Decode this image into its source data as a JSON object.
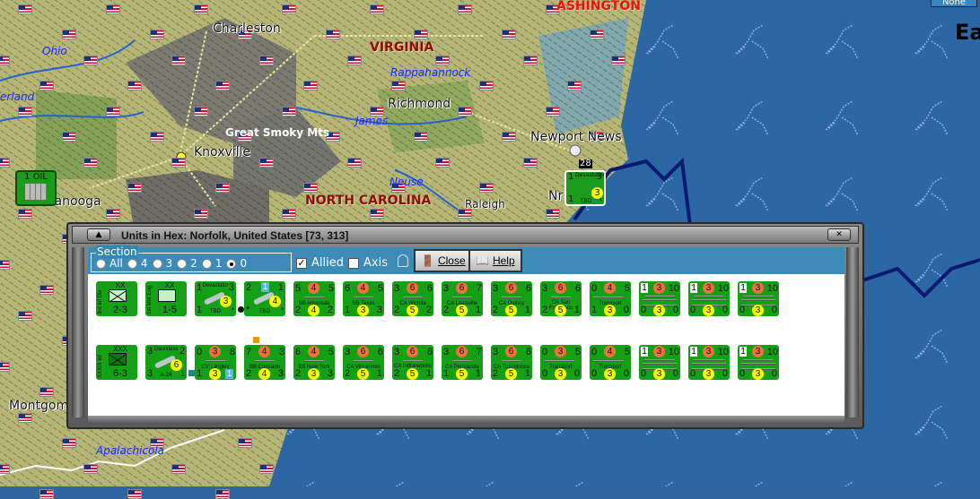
{
  "map": {
    "labels": {
      "charleston": "Charleston",
      "virginia": "VIRGINIA",
      "rappahannock": "Rappahannock",
      "richmond": "Richmond",
      "ohio": "Ohio",
      "cumberland": "erland",
      "james": "James",
      "smoky": "Great Smoky Mts",
      "knoxville": "Knoxville",
      "newport": "Newport News",
      "neuse": "Neuse",
      "nc": "NORTH CAROLINA",
      "raleigh": "Raleigh",
      "chattanooga": "tanooga",
      "washington": "ASHINGTON",
      "east": "Ea",
      "norfolk": "Nr",
      "montgomery": "Montgom",
      "apalachicola": "Apalachicola",
      "stack_count": "28"
    },
    "oil_counter": "1 OIL",
    "none_button": "None",
    "map_unit": {
      "tl": "1",
      "title": "Devastator",
      "tr": "3",
      "badge": "3",
      "bl": "1",
      "name": "TBD",
      "br": "*"
    }
  },
  "dialog": {
    "title": "Units in Hex: Norfolk, United States [73, 313]",
    "section_label": "Section",
    "section_options": [
      "All",
      "4",
      "3",
      "2",
      "1",
      "0"
    ],
    "section_selected": "0",
    "allied_label": "Allied",
    "allied_checked": true,
    "axis_label": "Axis",
    "axis_checked": false,
    "close_label": "Close",
    "help_label": "Help"
  },
  "units": [
    [
      {
        "kind": "land",
        "vlabel": "3rd Inf Div",
        "size": "XX",
        "str": "2-3",
        "sym": "inf"
      },
      {
        "kind": "land",
        "vlabel": "1st Mot Eng",
        "size": "XX",
        "str": "1-5",
        "sym": "eng"
      },
      {
        "kind": "air",
        "tl": "1",
        "title": "Devastator",
        "tr": "3",
        "badge": "3",
        "bl": "1",
        "name": "TBD",
        "br": "*",
        "marker": "black"
      },
      {
        "kind": "air",
        "tl": "2",
        "tcBox": "1",
        "tr": "1",
        "badge": "4",
        "bl": "*",
        "name": "TBD",
        "br": "*"
      },
      {
        "kind": "ship",
        "t": [
          "5",
          "4",
          "5"
        ],
        "name": "BB Arkansas",
        "b": [
          "2",
          "4",
          "2"
        ]
      },
      {
        "kind": "ship",
        "t": [
          "6",
          "4",
          "5"
        ],
        "name": "BB Texas",
        "b": [
          "1",
          "3",
          "3"
        ]
      },
      {
        "kind": "ship",
        "t": [
          "3",
          "6",
          "6"
        ],
        "name": "CA Wichita",
        "b": [
          "2",
          "5",
          "2"
        ]
      },
      {
        "kind": "ship",
        "t": [
          "3",
          "6",
          "7"
        ],
        "name": "CA Louisville",
        "b": [
          "2",
          "5",
          "1"
        ]
      },
      {
        "kind": "ship",
        "t": [
          "3",
          "6",
          "6"
        ],
        "name": "CA Quincy",
        "b": [
          "2",
          "5",
          "1"
        ]
      },
      {
        "kind": "ship",
        "t": [
          "3",
          "6",
          "6"
        ],
        "name": "CA San Francisco",
        "b": [
          "2",
          "5",
          "1"
        ]
      },
      {
        "kind": "transport",
        "t": [
          "0",
          "4",
          "5"
        ],
        "name": "Transport",
        "b": [
          "1",
          "3",
          "0"
        ]
      },
      {
        "kind": "convoy",
        "t": [
          "1",
          "3",
          "10"
        ],
        "b": [
          "0",
          "3",
          "0"
        ]
      },
      {
        "kind": "convoy",
        "t": [
          "1",
          "3",
          "10"
        ],
        "b": [
          "0",
          "3",
          "0"
        ]
      },
      {
        "kind": "convoy",
        "t": [
          "1",
          "3",
          "10"
        ],
        "b": [
          "0",
          "3",
          "0"
        ]
      }
    ],
    [
      {
        "kind": "land",
        "vlabel": "XXXIX Inf",
        "size": "XXX",
        "str": "6-3",
        "sym": "corps"
      },
      {
        "kind": "air",
        "tl": "3",
        "title": "Dauntless",
        "tr": "2",
        "badge": "6",
        "bl": "3",
        "name": "A-24",
        "br": "1",
        "marker": "teal"
      },
      {
        "kind": "ship",
        "t": [
          "0",
          "3",
          "8"
        ],
        "name": "CV Langley",
        "b": [
          "1",
          "3",
          "1"
        ],
        "brBox": true
      },
      {
        "kind": "ship",
        "t": [
          "7",
          "4",
          "3"
        ],
        "name": "BB Colorado",
        "b": [
          "2",
          "4",
          "3"
        ],
        "marker": "orange"
      },
      {
        "kind": "ship",
        "t": [
          "6",
          "4",
          "5"
        ],
        "name": "BB New York",
        "b": [
          "2",
          "3",
          "3"
        ]
      },
      {
        "kind": "ship",
        "t": [
          "3",
          "6",
          "6"
        ],
        "name": "CA Vincennes",
        "b": [
          "2",
          "5",
          "1"
        ]
      },
      {
        "kind": "ship",
        "t": [
          "3",
          "6",
          "6"
        ],
        "name": "CA Indianapolis",
        "b": [
          "2",
          "5",
          "1"
        ]
      },
      {
        "kind": "ship",
        "t": [
          "3",
          "6",
          "7"
        ],
        "name": "CA Pensacola",
        "b": [
          "1",
          "5",
          "1"
        ]
      },
      {
        "kind": "ship",
        "t": [
          "3",
          "6",
          "6"
        ],
        "name": "CA Tuscaloosa",
        "b": [
          "2",
          "5",
          "1"
        ]
      },
      {
        "kind": "transport",
        "t": [
          "0",
          "3",
          "5"
        ],
        "name": "Transport",
        "b": [
          "0",
          "3",
          "0"
        ]
      },
      {
        "kind": "transport",
        "t": [
          "0",
          "4",
          "5"
        ],
        "name": "Transport",
        "b": [
          "0",
          "3",
          "0"
        ]
      },
      {
        "kind": "convoy",
        "t": [
          "1",
          "3",
          "10"
        ],
        "b": [
          "0",
          "3",
          "0"
        ]
      },
      {
        "kind": "convoy",
        "t": [
          "1",
          "3",
          "10"
        ],
        "b": [
          "0",
          "3",
          "0"
        ]
      },
      {
        "kind": "convoy",
        "t": [
          "1",
          "3",
          "10"
        ],
        "b": [
          "0",
          "3",
          "0"
        ]
      }
    ]
  ],
  "colors": {
    "counter": "#14a014",
    "sea": "#2f65a0",
    "land": "#b8b878",
    "dialog_bar": "#3d8cb8"
  }
}
